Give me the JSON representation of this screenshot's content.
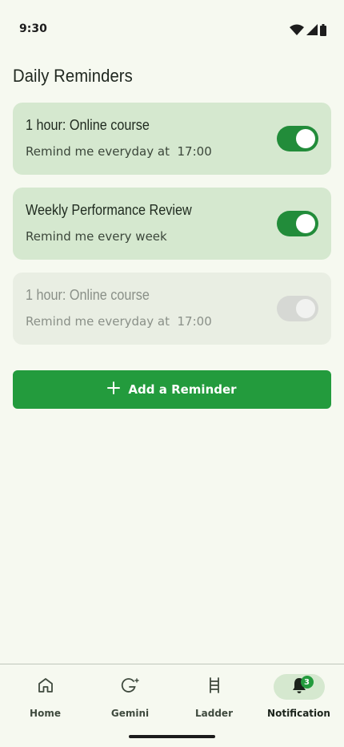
{
  "status_bar": {
    "time": "9:30",
    "icons": [
      "wifi-icon",
      "signal-icon",
      "battery-icon"
    ]
  },
  "page": {
    "title": "Daily Reminders"
  },
  "reminders": [
    {
      "title": "1 hour: Online course",
      "subtitle": "Remind me everyday at  17:00",
      "enabled": true
    },
    {
      "title": "Weekly Performance Review",
      "subtitle": "Remind me every week",
      "enabled": true
    },
    {
      "title": "1 hour: Online course",
      "subtitle": "Remind me everyday at  17:00",
      "enabled": false
    }
  ],
  "add_button": {
    "label": "Add a Reminder",
    "icon": "plus-icon"
  },
  "bottom_nav": {
    "items": [
      {
        "label": "Home",
        "icon": "home-icon",
        "active": false
      },
      {
        "label": "Gemini",
        "icon": "gemini-icon",
        "active": false
      },
      {
        "label": "Ladder",
        "icon": "ladder-icon",
        "active": false
      },
      {
        "label": "Notification",
        "icon": "bell-icon",
        "active": true,
        "badge": "3"
      }
    ]
  },
  "colors": {
    "background": "#f6f9f0",
    "card_active": "#d5e8cf",
    "card_disabled": "#e9eee3",
    "accent": "#239b3d",
    "toggle_on": "#228c3a",
    "toggle_off": "#d6d8d4"
  }
}
